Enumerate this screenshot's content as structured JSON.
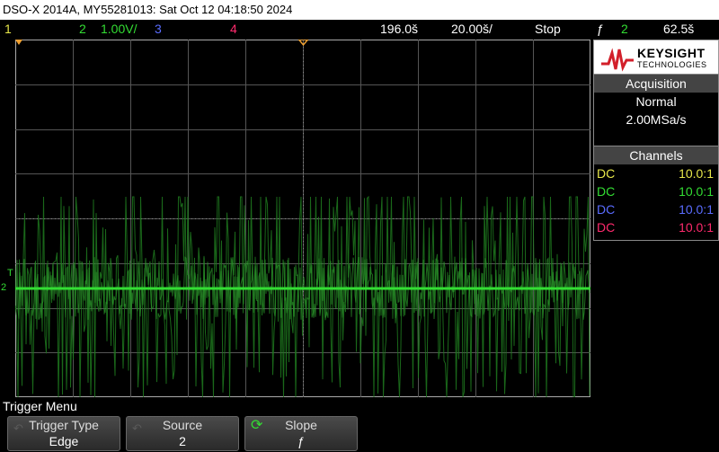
{
  "title_bar": {
    "text": "DSO-X 2014A, MY55281013: Sat Oct 12 04:18:50 2024"
  },
  "status": {
    "ch1": "1",
    "ch2": "2",
    "ch2_scale": "1.00V/",
    "ch3": "3",
    "ch4": "4",
    "time_delay": "196.0š",
    "time_scale": "20.00š/",
    "run_state": "Stop",
    "trigger_slope_icon": "ƒ",
    "trigger_source": "2",
    "trigger_level": "62.5š"
  },
  "logo": {
    "name": "KEYSIGHT",
    "sub": "TECHNOLOGIES"
  },
  "acquisition": {
    "header": "Acquisition",
    "mode": "Normal",
    "rate": "2.00MSa/s"
  },
  "channels": {
    "header": "Channels",
    "rows": [
      {
        "coupling": "DC",
        "probe": "10.0:1",
        "color": "#e8e84a"
      },
      {
        "coupling": "DC",
        "probe": "10.0:1",
        "color": "#33dd33"
      },
      {
        "coupling": "DC",
        "probe": "10.0:1",
        "color": "#5a6cff"
      },
      {
        "coupling": "DC",
        "probe": "10.0:1",
        "color": "#ff2a6d"
      }
    ]
  },
  "markers": {
    "trigger": "T",
    "ground": "2"
  },
  "menu": {
    "label": "Trigger Menu",
    "softkeys": [
      {
        "top": "Trigger Type",
        "value": "Edge"
      },
      {
        "top": "Source",
        "value": "2"
      },
      {
        "top": "Slope",
        "value": "ƒ"
      }
    ]
  },
  "colors": {
    "trace": "#33dd33",
    "grid": "#555555",
    "background": "#000000"
  }
}
